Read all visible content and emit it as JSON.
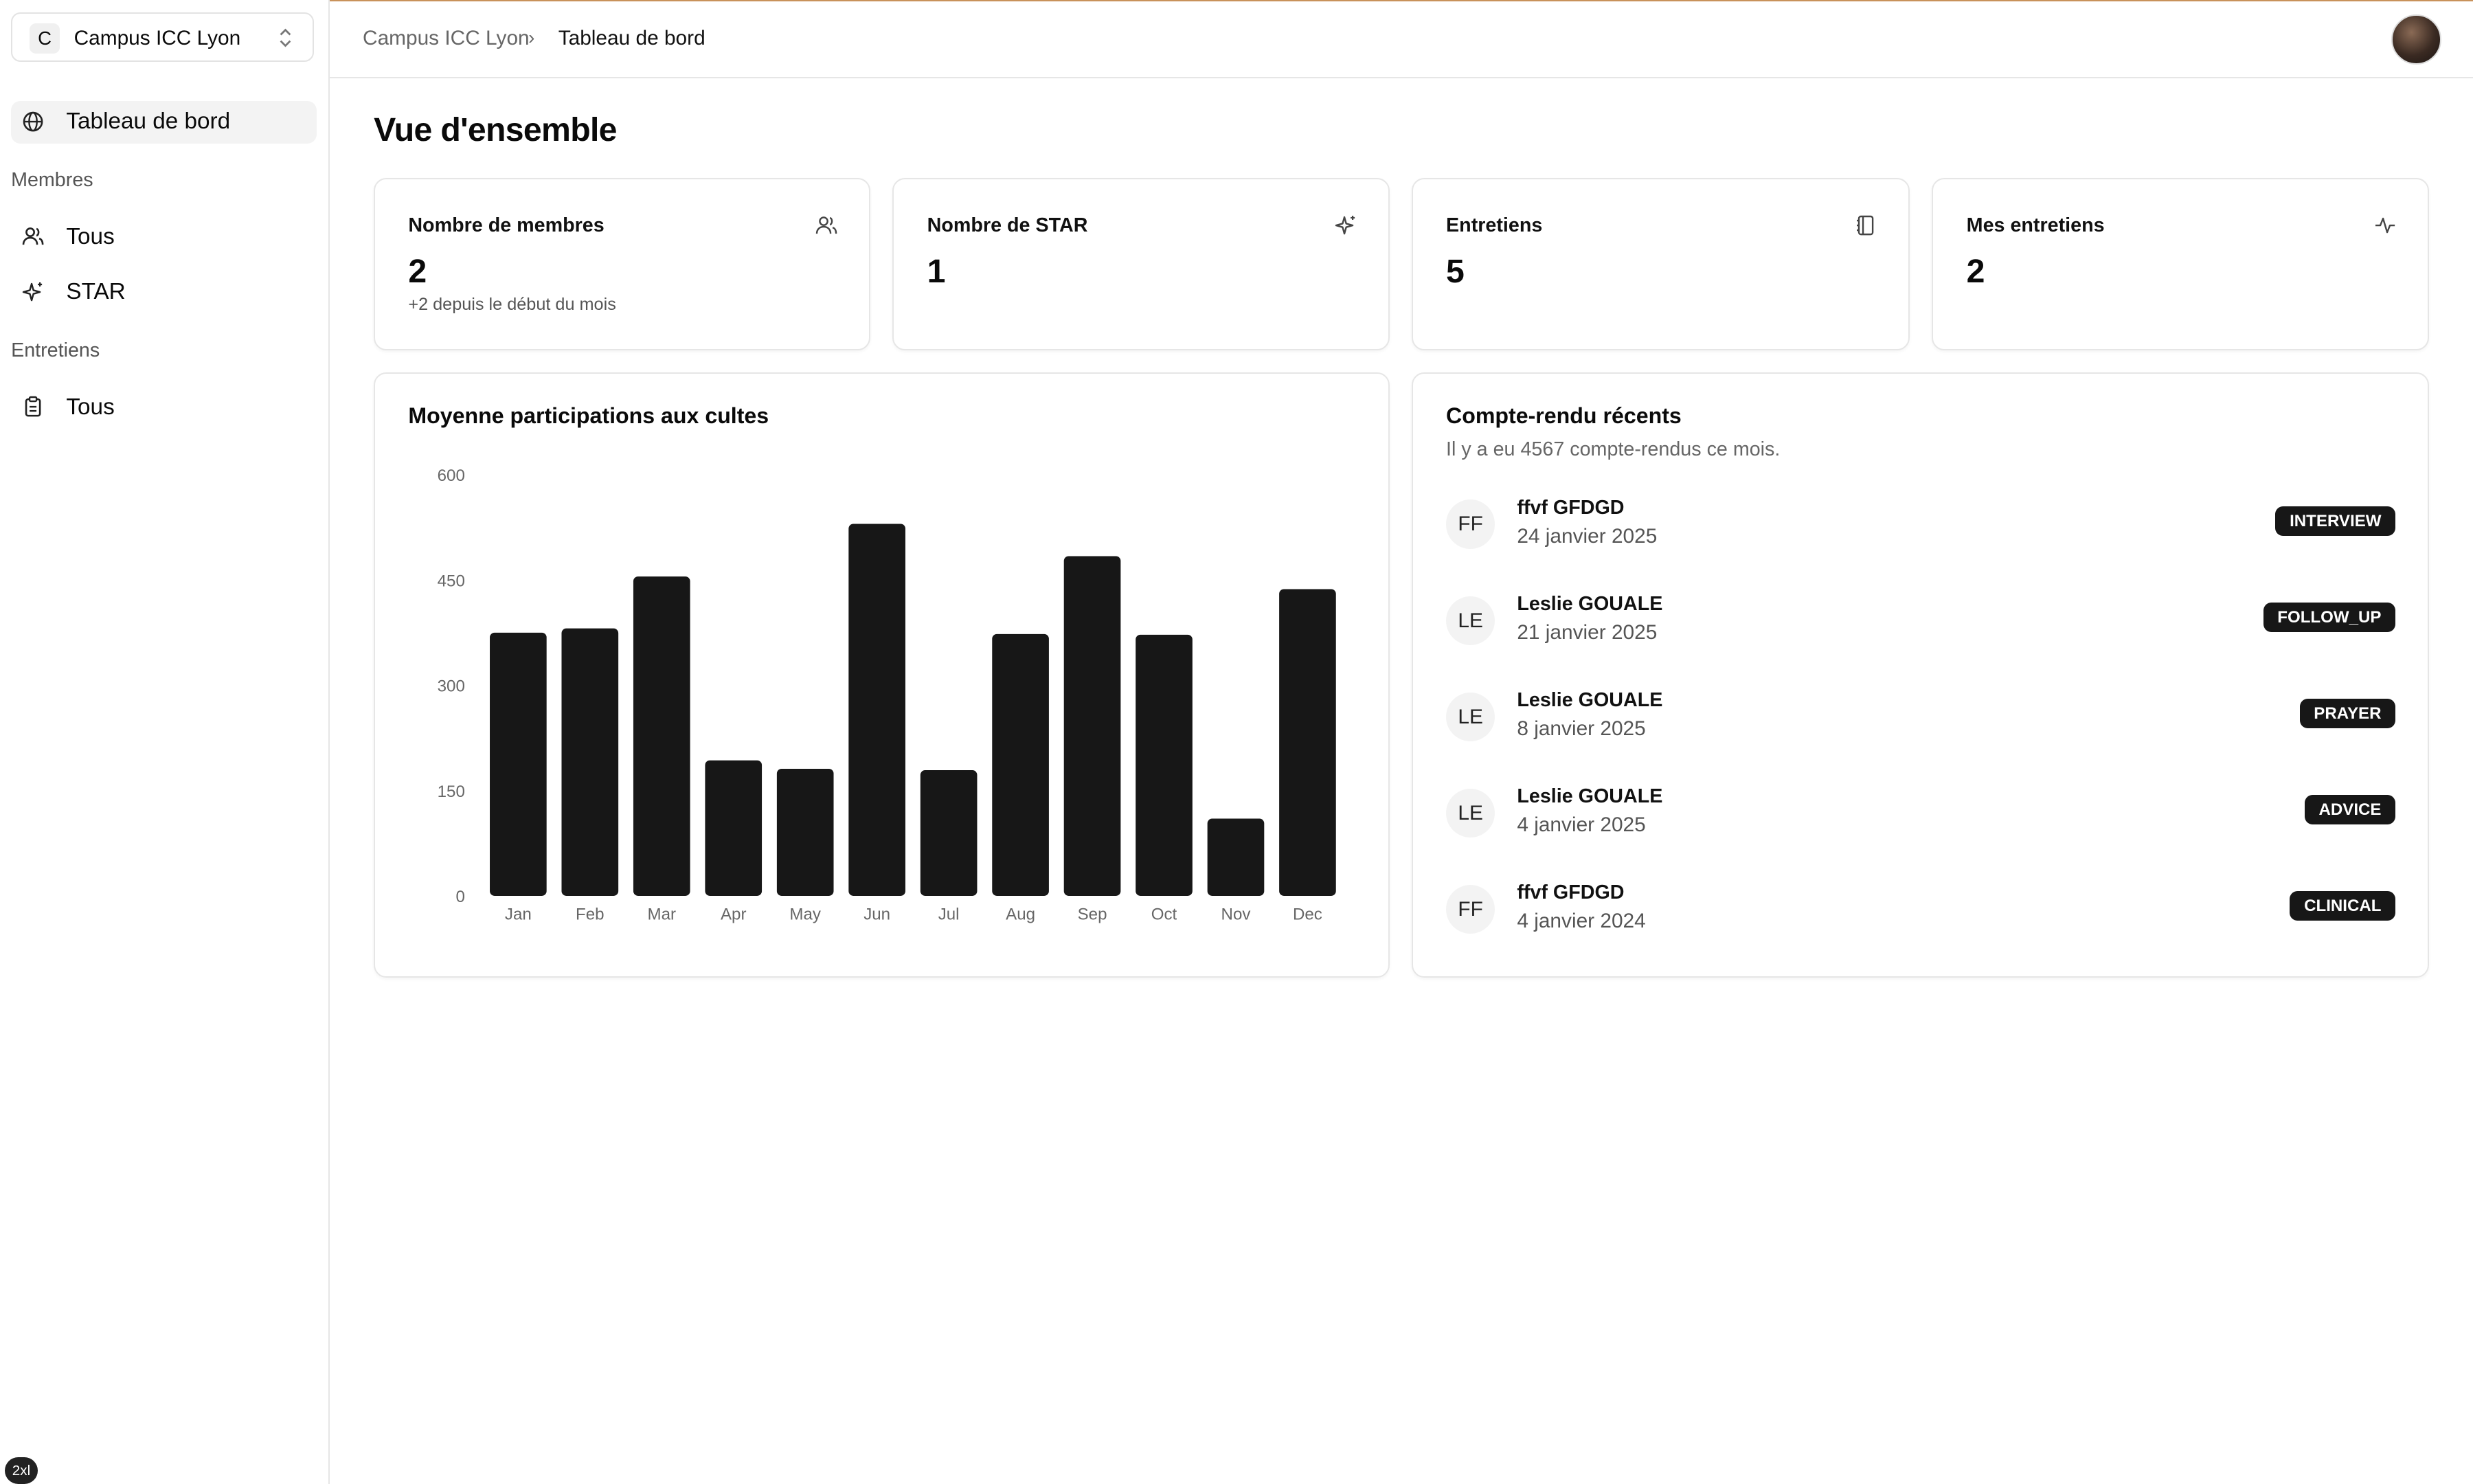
{
  "sidebar": {
    "campus_letter": "C",
    "campus_name": "Campus ICC Lyon",
    "dashboard_label": "Tableau de bord",
    "section_members": "Membres",
    "members_all": "Tous",
    "members_star": "STAR",
    "section_interviews": "Entretiens",
    "interviews_all": "Tous",
    "screen_badge": "2xl"
  },
  "header": {
    "breadcrumb_root": "Campus ICC Lyon",
    "breadcrumb_sep": "›",
    "breadcrumb_current": "Tableau de bord"
  },
  "main": {
    "title": "Vue d'ensemble",
    "stats": [
      {
        "title": "Nombre de membres",
        "value": "2",
        "sub": "+2 depuis le début du mois",
        "icon": "users-icon"
      },
      {
        "title": "Nombre de STAR",
        "value": "1",
        "sub": "",
        "icon": "sparkles-icon"
      },
      {
        "title": "Entretiens",
        "value": "5",
        "sub": "",
        "icon": "notebook-icon"
      },
      {
        "title": "Mes entretiens",
        "value": "2",
        "sub": "",
        "icon": "activity-icon"
      }
    ],
    "chart_card_title": "Moyenne participations aux cultes",
    "reports": {
      "title": "Compte-rendu récents",
      "subtitle": "Il y a eu 4567 compte-rendus ce mois.",
      "items": [
        {
          "initials": "FF",
          "name": "ffvf GFDGD",
          "date": "24 janvier 2025",
          "tag": "INTERVIEW"
        },
        {
          "initials": "LE",
          "name": "Leslie GOUALE",
          "date": "21 janvier 2025",
          "tag": "FOLLOW_UP"
        },
        {
          "initials": "LE",
          "name": "Leslie GOUALE",
          "date": "8 janvier 2025",
          "tag": "PRAYER"
        },
        {
          "initials": "LE",
          "name": "Leslie GOUALE",
          "date": "4 janvier 2025",
          "tag": "ADVICE"
        },
        {
          "initials": "FF",
          "name": "ffvf GFDGD",
          "date": "4 janvier 2024",
          "tag": "CLINICAL"
        }
      ]
    }
  },
  "chart_data": {
    "type": "bar",
    "title": "Moyenne participations aux cultes",
    "categories": [
      "Jan",
      "Feb",
      "Mar",
      "Apr",
      "May",
      "Jun",
      "Jul",
      "Aug",
      "Sep",
      "Oct",
      "Nov",
      "Dec"
    ],
    "values": [
      375,
      381,
      455,
      193,
      181,
      530,
      179,
      373,
      484,
      372,
      110,
      437
    ],
    "ylim": [
      0,
      600
    ],
    "yticks": [
      0,
      150,
      300,
      450,
      600
    ],
    "bar_color": "#171717",
    "grid": false
  },
  "colors": {
    "accent_line": "#c8925a",
    "tag_background": "#171717",
    "active_nav_background": "#f3f3f3"
  }
}
